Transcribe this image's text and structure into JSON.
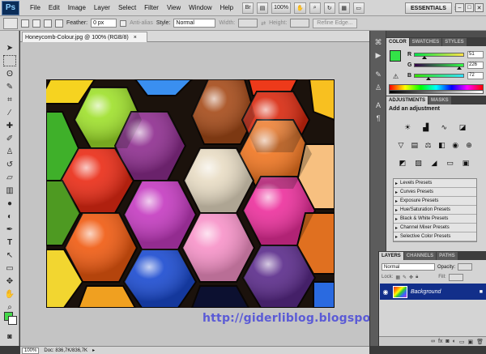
{
  "menubar": {
    "logo": "Ps",
    "items": [
      "File",
      "Edit",
      "Image",
      "Layer",
      "Select",
      "Filter",
      "View",
      "Window",
      "Help"
    ],
    "zoom_value": "100%",
    "workspace": "ESSENTIALS"
  },
  "options": {
    "feather_label": "Feather:",
    "feather_value": "0 px",
    "antialias_label": "Anti-alias",
    "style_label": "Style:",
    "style_value": "Normal",
    "width_label": "Width:",
    "height_label": "Height:",
    "refine_label": "Refine Edge..."
  },
  "document": {
    "tab_title": "Honeycomb-Colour.jpg @ 100% (RGB/8)",
    "close_glyph": "×",
    "watermark": "http://giderliblog.blogspot.com"
  },
  "status": {
    "zoom": "100%",
    "doc_info": "Doc: 836,7K/836,7K"
  },
  "color_panel": {
    "tabs": [
      "COLOR",
      "SWATCHES",
      "STYLES"
    ],
    "channels": [
      {
        "label": "R",
        "value": "51",
        "level": 0.2
      },
      {
        "label": "G",
        "value": "226",
        "level": 0.886
      },
      {
        "label": "B",
        "value": "72",
        "level": 0.282
      }
    ],
    "foreground": "#33e248"
  },
  "adjustments_panel": {
    "tabs": [
      "ADJUSTMENTS",
      "MASKS"
    ],
    "title": "Add an adjustment",
    "presets": [
      "Levels Presets",
      "Curves Presets",
      "Exposure Presets",
      "Hue/Saturation Presets",
      "Black & White Presets",
      "Channel Mixer Presets",
      "Selective Color Presets"
    ]
  },
  "layers_panel": {
    "tabs": [
      "LAYERS",
      "CHANNELS",
      "PATHS"
    ],
    "blend_mode": "Normal",
    "opacity_label": "Opacity:",
    "lock_label": "Lock:",
    "fill_label": "Fill:",
    "layer_name": "Background"
  },
  "colors": {
    "foreground": "#44d84a",
    "background": "#ffffff",
    "selected_layer": "#122f8a"
  }
}
